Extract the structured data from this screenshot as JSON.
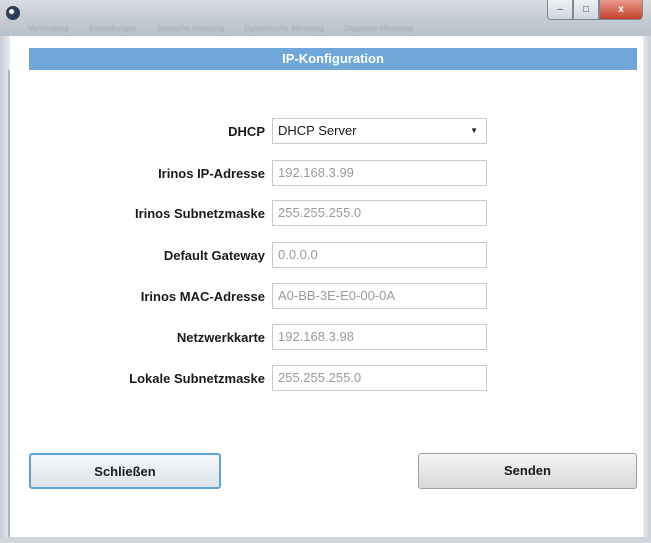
{
  "window": {
    "tabs_blurred": [
      "Verbindung",
      "Einstellungen",
      "Statische Messung",
      "Dynamische Messung",
      "Diagnose-Messung"
    ],
    "buttons": {
      "minimize": "–",
      "maximize": "□",
      "close": "x"
    }
  },
  "header": {
    "title": "IP-Konfiguration"
  },
  "form": {
    "dhcp": {
      "label": "DHCP",
      "value": "DHCP Server",
      "arrow": "▼"
    },
    "ip": {
      "label": "Irinos IP-Adresse",
      "value": "192.168.3.99"
    },
    "subnet": {
      "label": "Irinos Subnetzmaske",
      "value": "255.255.255.0"
    },
    "gateway": {
      "label": "Default Gateway",
      "value": "0.0.0.0"
    },
    "mac": {
      "label": "Irinos MAC-Adresse",
      "value": "A0-BB-3E-E0-00-0A"
    },
    "nic": {
      "label": "Netzwerkkarte",
      "value": "192.168.3.98"
    },
    "local_subnet": {
      "label": "Lokale Subnetzmaske",
      "value": "255.255.255.0"
    }
  },
  "actions": {
    "close_label": "Schließen",
    "send_label": "Senden"
  },
  "colors": {
    "header": "#6fa8d8",
    "focus_border": "#5ea3d8",
    "close_btn": "#c5402c"
  }
}
